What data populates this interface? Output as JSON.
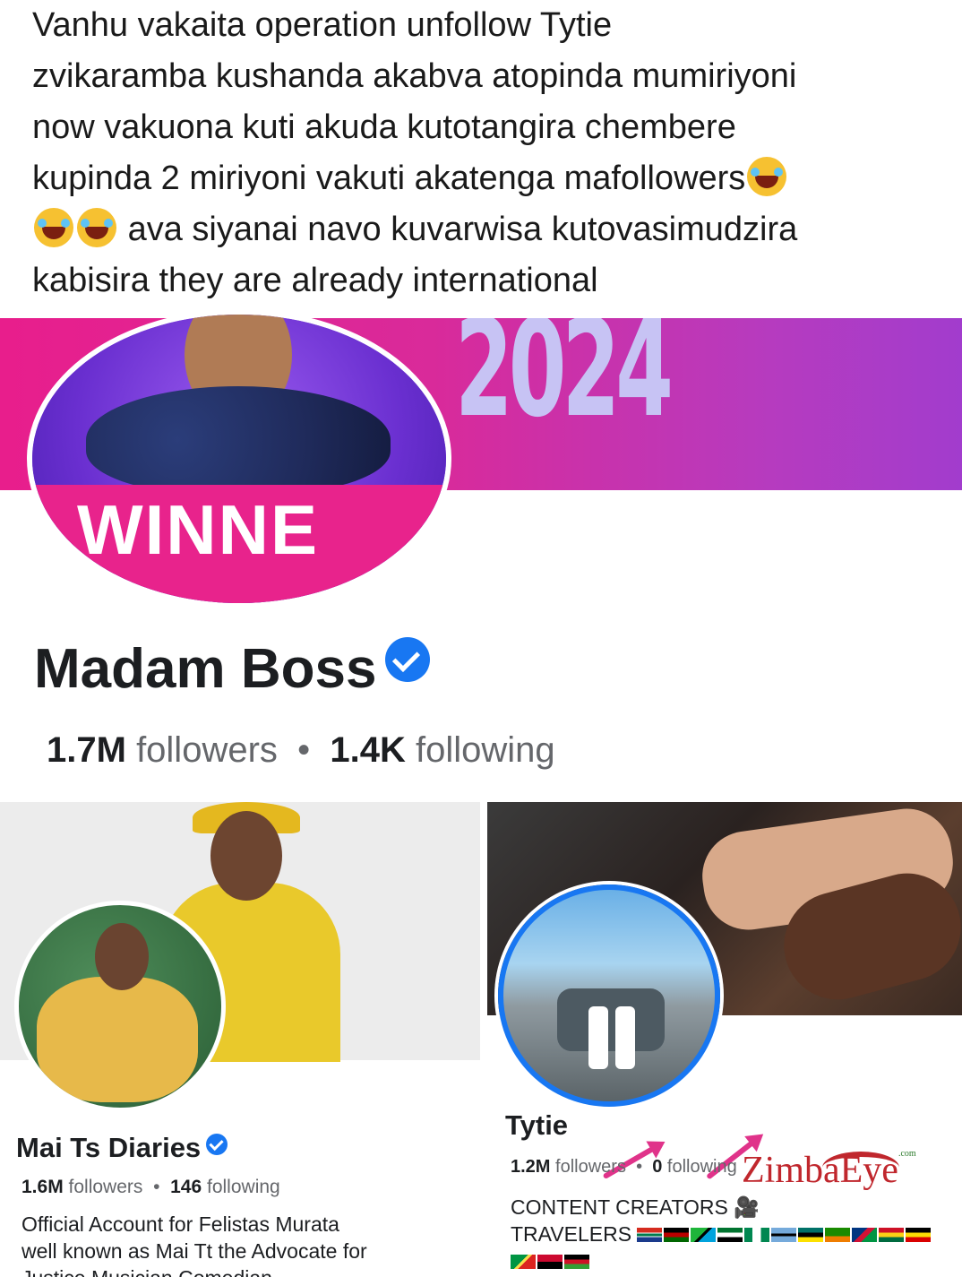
{
  "post": {
    "line1": "Vanhu vakaita operation unfollow Tytie",
    "line2": "zvikaramba kushanda akabva atopinda mumiriyoni",
    "line3": "now vakuona kuti akuda kutotangira chembere",
    "line4": "kupinda 2 miriyoni vakuti akatenga mafollowers",
    "line5": "ava siyanai navo kuvarwisa kutovasimudzira",
    "line6": "kabisira they are already international"
  },
  "main_profile": {
    "cover_text": "2024",
    "avatar_text": "WINNE",
    "name": "Madam Boss",
    "followers_count": "1.7M",
    "followers_label": "followers",
    "separator": "•",
    "following_count": "1.4K",
    "following_label": "following"
  },
  "left_profile": {
    "name": "Mai Ts Diaries",
    "followers_count": "1.6M",
    "followers_label": "followers",
    "separator": "•",
    "following_count": "146",
    "following_label": "following",
    "bio_line1": "Official Account for Felistas Murata",
    "bio_line2": "well known as Mai Tt the Advocate for",
    "bio_line3": "Justice Musician Comedian"
  },
  "right_profile": {
    "name": "Tytie",
    "followers_count": "1.2M",
    "followers_label": "followers",
    "separator": "•",
    "following_count": "0",
    "following_label": "following",
    "bio_line1": "CONTENT CREATORS",
    "bio_line2": "TRAVELERS"
  },
  "watermark": {
    "text": "ZimbaEye",
    "sub": ".com"
  },
  "colors": {
    "verified": "#1877f2",
    "cover_pink": "#e81e8c",
    "arrow": "#e0338a"
  }
}
